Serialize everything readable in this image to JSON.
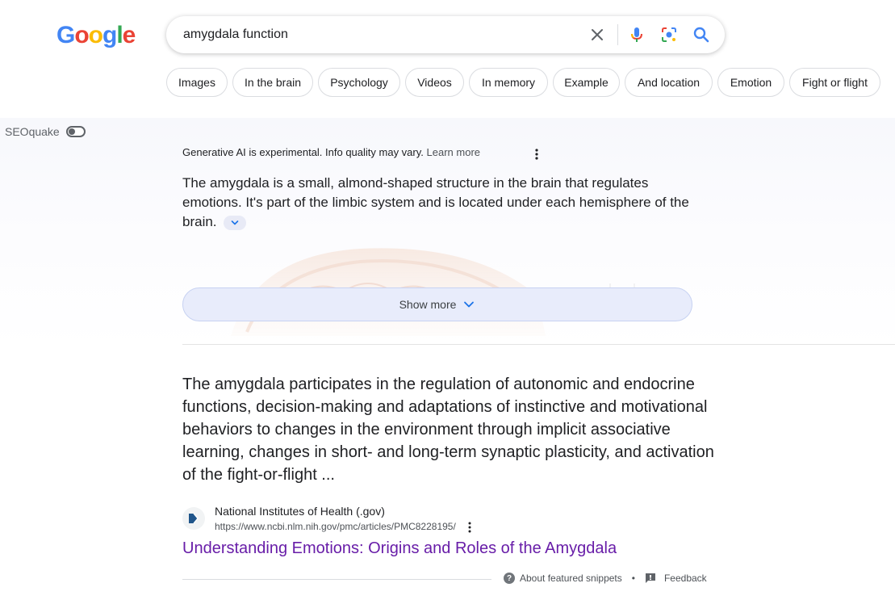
{
  "logo": {
    "letters": [
      "G",
      "o",
      "o",
      "g",
      "l",
      "e"
    ],
    "colors": [
      "#4285F4",
      "#EA4335",
      "#FBBC05",
      "#4285F4",
      "#34A853",
      "#EA4335"
    ]
  },
  "search": {
    "query": "amygdala function"
  },
  "chips": [
    "Images",
    "In the brain",
    "Psychology",
    "Videos",
    "In memory",
    "Example",
    "And location",
    "Emotion",
    "Fight or flight"
  ],
  "seoquake": {
    "label": "SEOquake"
  },
  "ai_overview": {
    "notice": "Generative AI is experimental. Info quality may vary.",
    "learn_more": "Learn more",
    "text": "The amygdala is a small, almond-shaped structure in the brain that regulates emotions. It's part of the limbic system and is located under each hemisphere of the brain.",
    "show_more": "Show more"
  },
  "featured_snippet": {
    "text": "The amygdala participates in the regulation of autonomic and endocrine functions, decision-making and adaptations of instinctive and motivational behaviors to changes in the environment through implicit associative learning, changes in short- and long-term synaptic plasticity, and activation of the fight-or-flight ...",
    "source_name": "National Institutes of Health (.gov)",
    "source_url": "https://www.ncbi.nlm.nih.gov/pmc/articles/PMC8228195/",
    "title": "Understanding Emotions: Origins and Roles of the Amygdala",
    "about_link": "About featured snippets",
    "feedback": "Feedback"
  }
}
